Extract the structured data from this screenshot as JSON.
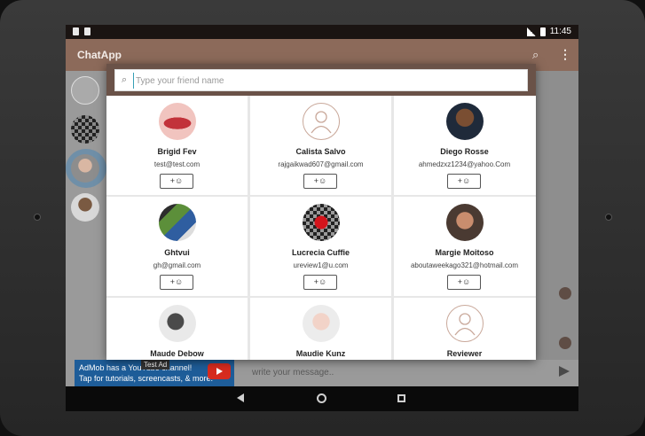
{
  "app": {
    "title": "ChatApp",
    "clock": "11:45"
  },
  "search": {
    "placeholder": "Type your friend name"
  },
  "ad": {
    "line1": "AdMob has a YouTube channel!",
    "line2": "Tap for tutorials, screencasts, & more.",
    "badge": "Test Ad"
  },
  "composer": {
    "placeholder": "write your message.."
  },
  "icons": {
    "search": "search-icon",
    "more": "more-vert-icon",
    "add_friend": "person-add-icon",
    "back": "back-icon",
    "home": "home-icon",
    "recents": "recents-icon",
    "send": "send-icon"
  },
  "colors": {
    "appbar": "#8c6a5a",
    "dialog_header": "#6a5248",
    "accent": "#36a0b6"
  },
  "friends": [
    {
      "name": "Brigid Fev",
      "email": "test@test.com",
      "avatar": "lips-photo",
      "add_label": "+☺"
    },
    {
      "name": "Calista Salvo",
      "email": "rajgaikwad607@gmail.com",
      "avatar": "default-person",
      "add_label": "+☺"
    },
    {
      "name": "Diego Rosse",
      "email": "ahmedzxz1234@yahoo.Com",
      "avatar": "man-photo",
      "add_label": "+☺"
    },
    {
      "name": "Ghtvui",
      "email": "gh@gmail.com",
      "avatar": "collage-photo",
      "add_label": "+☺"
    },
    {
      "name": "Lucrecia Cuffie",
      "email": "ureview1@u.com",
      "avatar": "checker-red-photo",
      "add_label": "+☺"
    },
    {
      "name": "Margie Moitoso",
      "email": "aboutaweekago321@hotmail.com",
      "avatar": "man-smiling-photo",
      "add_label": "+☺"
    },
    {
      "name": "Maude Debow",
      "email": "",
      "avatar": "bw-person-photo",
      "add_label": "+☺"
    },
    {
      "name": "Maudie Kunz",
      "email": "",
      "avatar": "baby-photo",
      "add_label": "+☺"
    },
    {
      "name": "Reviewer",
      "email": "",
      "avatar": "default-person",
      "add_label": "+☺"
    }
  ]
}
